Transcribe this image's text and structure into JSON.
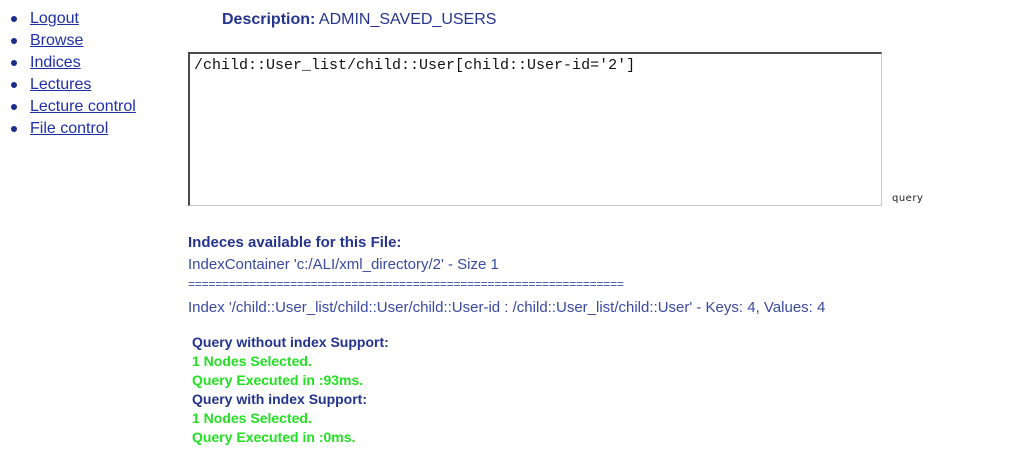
{
  "nav": {
    "items": [
      {
        "label": "Logout"
      },
      {
        "label": "Browse"
      },
      {
        "label": "Indices"
      },
      {
        "label": "Lectures"
      },
      {
        "label": "Lecture control"
      },
      {
        "label": "File control"
      }
    ]
  },
  "description": {
    "label": "Description:",
    "value": "ADMIN_SAVED_USERS"
  },
  "query": {
    "value": "/child::User_list/child::User[child::User-id='2']",
    "button_label": "query"
  },
  "indices": {
    "heading": "Indeces available for this File:",
    "container": "IndexContainer 'c:/ALI/xml_directory/2' - Size 1",
    "separator": "================================================================",
    "index_line": "Index '/child::User_list/child::User/child::User-id : /child::User_list/child::User' - Keys: 4, Values: 4"
  },
  "results": {
    "without_heading": "Query without index Support:",
    "without_nodes": "1 Nodes Selected.",
    "without_time": "Query Executed in :93ms.",
    "with_heading": "Query with index Support:",
    "with_nodes": "1 Nodes Selected.",
    "with_time": "Query Executed in :0ms."
  },
  "colors": {
    "link": "#1f2fa8",
    "heading": "#25358f",
    "success": "#22e022"
  }
}
